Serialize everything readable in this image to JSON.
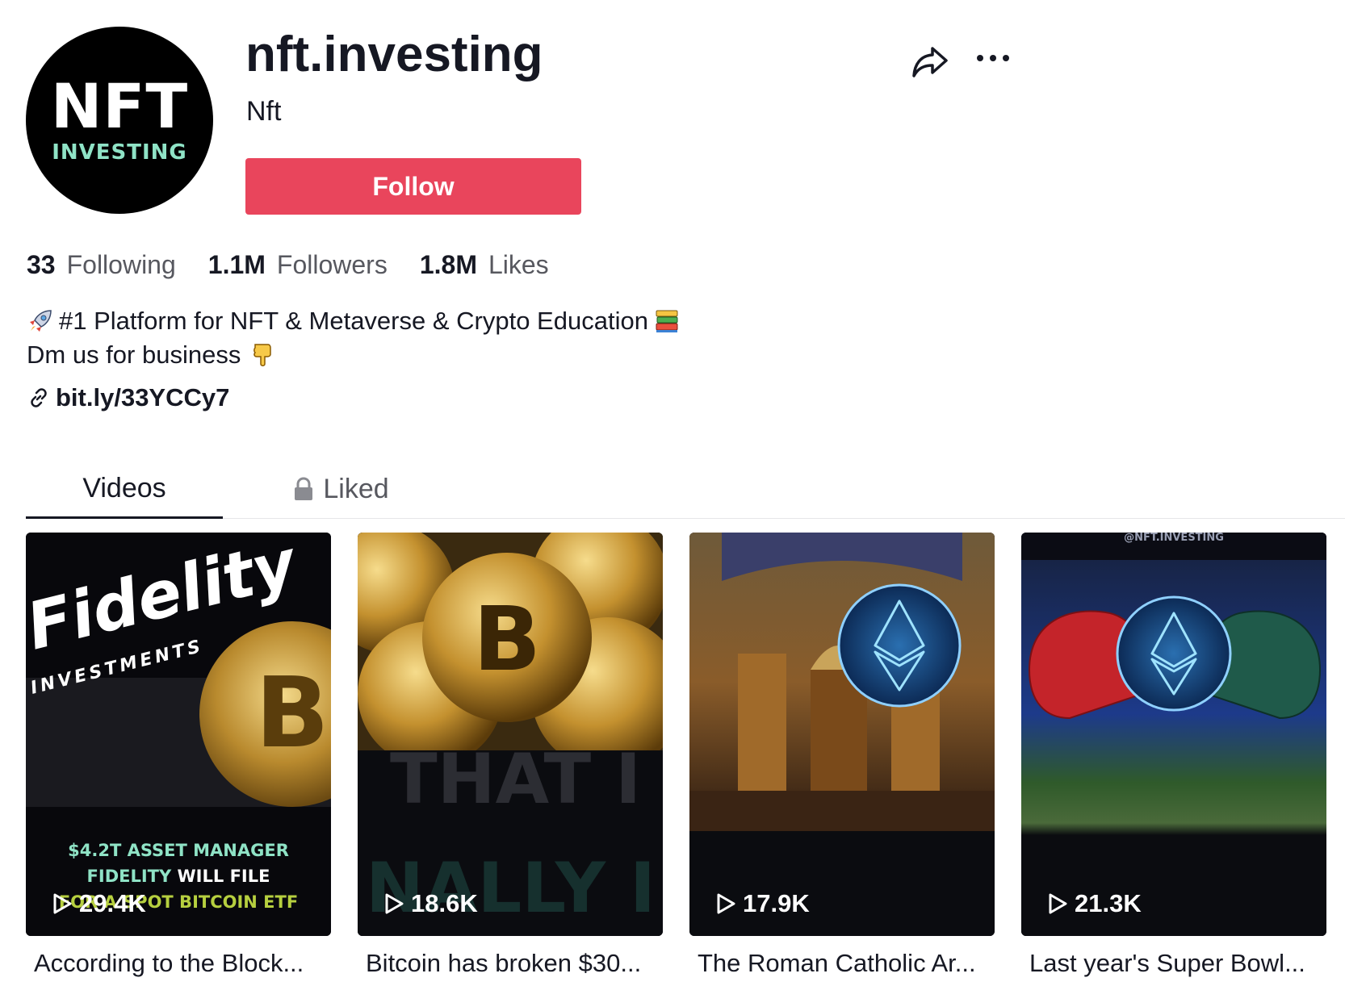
{
  "profile": {
    "username": "nft.investing",
    "nickname": "Nft",
    "avatar": {
      "line1": "NFT",
      "line2": "INVESTING"
    },
    "follow_label": "Follow"
  },
  "header_icons": {
    "share": "share-icon",
    "more": "more-icon"
  },
  "stats": {
    "following": {
      "count": "33",
      "label": "Following"
    },
    "followers": {
      "count": "1.1M",
      "label": "Followers"
    },
    "likes": {
      "count": "1.8M",
      "label": "Likes"
    }
  },
  "bio": {
    "line1": "#1 Platform for NFT & Metaverse & Crypto Education",
    "line2": "Dm us for business",
    "emojis": [
      "rocket-emoji",
      "books-emoji",
      "pointing-down-emoji"
    ]
  },
  "link": {
    "text": "bit.ly/33YCCy7",
    "icon": "link-icon"
  },
  "tabs": [
    {
      "label": "Videos",
      "active": true
    },
    {
      "label": "Liked",
      "icon": "lock-icon",
      "active": false
    }
  ],
  "videos": [
    {
      "views": "29.4K",
      "caption": "According to the Block...",
      "overlay": {
        "brand": "Fidelity",
        "brand_sub": "INVESTMENTS",
        "text1": "$4.2T ASSET MANAGER",
        "text2a": "FIDELITY",
        "text2b": " WILL FILE",
        "text3": "FOR A SPOT BITCOIN ETF"
      }
    },
    {
      "views": "18.6K",
      "caption": "Bitcoin has broken $30...",
      "overlay": {
        "text1": "THAT I",
        "text2": "NALLY I"
      }
    },
    {
      "views": "17.9K",
      "caption": "The Roman Catholic Ar...",
      "overlay": {}
    },
    {
      "views": "21.3K",
      "caption": "Last year's Super Bowl...",
      "overlay": {
        "watermark": "@NFT.INVESTING"
      }
    }
  ]
}
